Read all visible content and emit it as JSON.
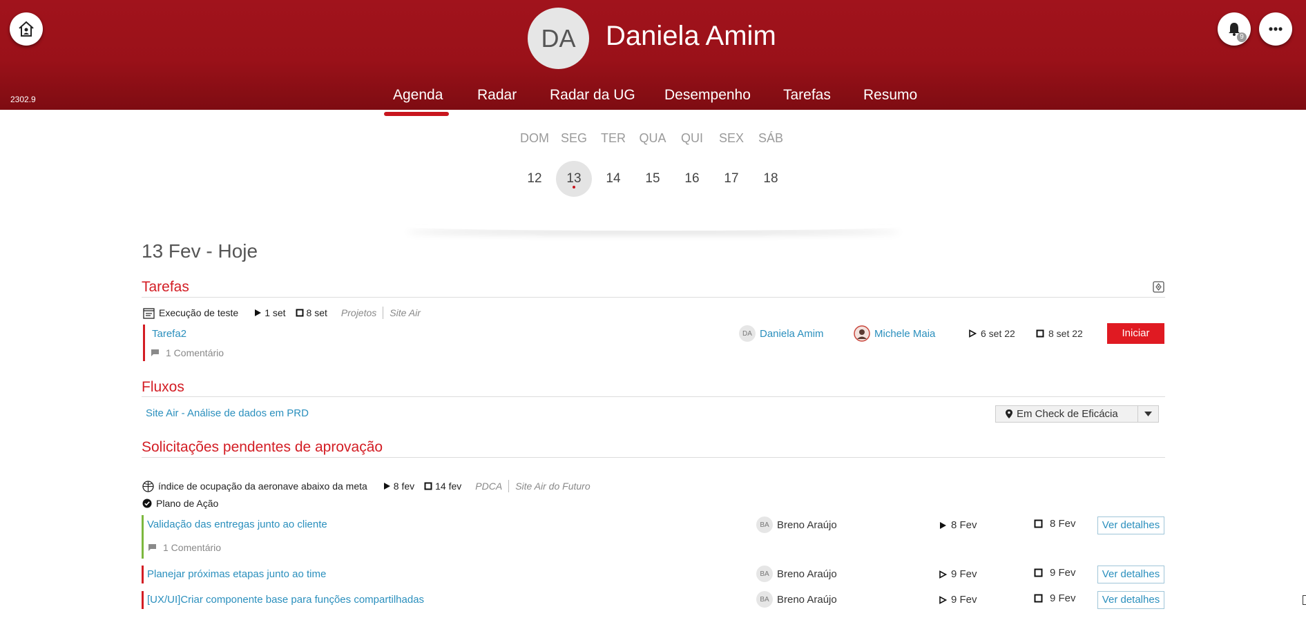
{
  "header": {
    "version": "2302.9",
    "user_initials": "DA",
    "user_name": "Daniela Amim",
    "notification_count": "9",
    "nav_tabs": [
      "Agenda",
      "Radar",
      "Radar da UG",
      "Desempenho",
      "Tarefas",
      "Resumo"
    ],
    "active_tab": "Agenda"
  },
  "week": {
    "day_names": [
      "DOM",
      "SEG",
      "TER",
      "QUA",
      "QUI",
      "SEX",
      "SÁB"
    ],
    "day_numbers": [
      "12",
      "13",
      "14",
      "15",
      "16",
      "17",
      "18"
    ],
    "selected_day": "13"
  },
  "content": {
    "date_title": "13 Fev - Hoje",
    "tarefas": {
      "title": "Tarefas",
      "activity": "Execução de teste",
      "start": "1 set",
      "end": "8 set",
      "category": "Projetos",
      "site": "Site Air",
      "task": {
        "name": "Tarefa2",
        "comments": "1 Comentário",
        "owner_initials": "DA",
        "owner": "Daniela Amim",
        "reviewer": "Michele Maia",
        "start": "6 set 22",
        "end": "8 set 22",
        "action": "Iniciar"
      }
    },
    "fluxos": {
      "title": "Fluxos",
      "flow_name": "Site Air - Análise de dados em PRD",
      "status": "Em Check de Eficácia"
    },
    "solicitacoes": {
      "title": "Solicitações pendentes de aprovação",
      "indicator": "índice de ocupação da aeronave abaixo da meta",
      "start": "8 fev",
      "end": "14 fev",
      "category": "PDCA",
      "site": "Site Air do Futuro",
      "plan": "Plano de Ação",
      "items": [
        {
          "name": "Validação das entregas junto ao cliente",
          "comments": "1 Comentário",
          "initials": "BA",
          "owner": "Breno Araújo",
          "start": "8 Fev",
          "end": "8 Fev",
          "action": "Ver detalhes"
        },
        {
          "name": "Planejar próximas etapas junto ao time",
          "initials": "BA",
          "owner": "Breno Araújo",
          "start": "9 Fev",
          "end": "9 Fev",
          "action": "Ver detalhes"
        },
        {
          "name": "[UX/UI]Criar componente base para funções compartilhadas",
          "initials": "BA",
          "owner": "Breno Araújo",
          "start": "9 Fev",
          "end": "9 Fev",
          "action": "Ver detalhes"
        }
      ]
    }
  },
  "colors": {
    "header_red": "#9a1119",
    "accent_red": "#d31d24",
    "link_blue": "#2a8fbd",
    "status_green": "#7cb83e"
  },
  "icons": [
    "home-icon",
    "bell-icon",
    "more-icon",
    "task-list-icon",
    "play-icon",
    "stop-icon",
    "comment-icon",
    "map-pin-icon",
    "chevron-down-icon",
    "globe-icon",
    "check-circle-icon",
    "add-task-icon"
  ]
}
